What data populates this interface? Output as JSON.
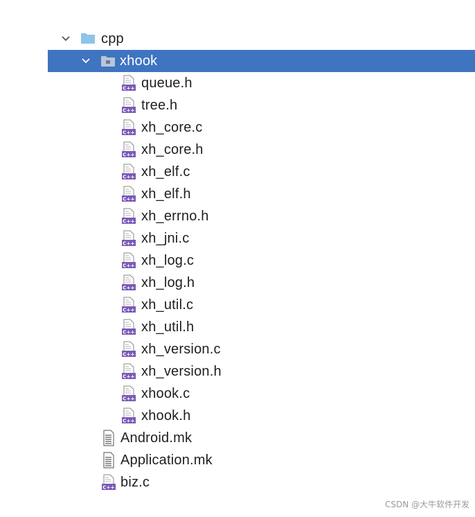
{
  "tree": {
    "cpp": {
      "label": "cpp"
    },
    "xhook": {
      "label": "xhook",
      "files": [
        "queue.h",
        "tree.h",
        "xh_core.c",
        "xh_core.h",
        "xh_elf.c",
        "xh_elf.h",
        "xh_errno.h",
        "xh_jni.c",
        "xh_log.c",
        "xh_log.h",
        "xh_util.c",
        "xh_util.h",
        "xh_version.c",
        "xh_version.h",
        "xhook.c",
        "xhook.h"
      ]
    },
    "mk_files": [
      "Android.mk",
      "Application.mk"
    ],
    "biz": {
      "label": "biz.c"
    }
  },
  "icons": {
    "folder": "folder-icon",
    "cpp_file": "cpp-file-icon",
    "text_file": "text-file-icon",
    "chevron": "chevron-down-icon"
  },
  "colors": {
    "selection": "#3f74c0",
    "folder": "#8fc3e8",
    "cpp_badge": "#7a5bb5"
  },
  "watermark": "CSDN @大牛软件开发"
}
